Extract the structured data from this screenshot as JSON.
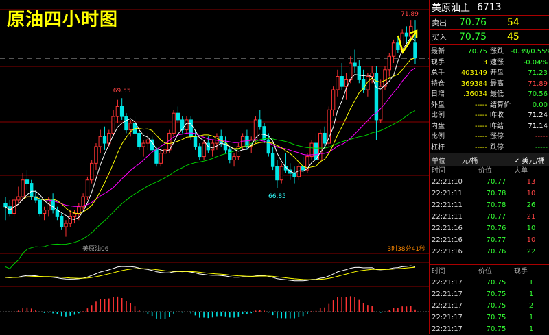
{
  "overlay_title": "原油四小时图",
  "chart": {
    "labels": {
      "high_mark": "69.55",
      "low_mark": "66.85",
      "peak_mark": "71.89"
    },
    "instrument": "美原油06",
    "countdown": "3时38分41秒"
  },
  "quote": {
    "name": "美原油主",
    "code": "6713",
    "ask_label": "卖出",
    "ask_price": "70.76",
    "ask_vol": "54",
    "bid_label": "买入",
    "bid_price": "70.75",
    "bid_vol": "45",
    "fields": [
      {
        "l1": "最新",
        "v1": "70.75",
        "c1": "g",
        "l2": "涨跌",
        "v2": "-0.39/0.55%",
        "c2": "g"
      },
      {
        "l1": "现手",
        "v1": "3",
        "c1": "y",
        "l2": "速涨",
        "v2": "-0.04%",
        "c2": "g"
      },
      {
        "l1": "总手",
        "v1": "403149",
        "c1": "y",
        "l2": "开盘",
        "v2": "71.23",
        "c2": "g"
      },
      {
        "l1": "持仓",
        "v1": "369384",
        "c1": "y",
        "l2": "最高",
        "v2": "71.89",
        "c2": "r"
      },
      {
        "l1": "日增",
        "v1": ".36034",
        "c1": "y",
        "l2": "最低",
        "v2": "70.56",
        "c2": "g"
      },
      {
        "l1": "外盘",
        "v1": "-----",
        "c1": "y",
        "l2": "结算价",
        "v2": "0.00",
        "c2": "g"
      },
      {
        "l1": "比例",
        "v1": "-----",
        "c1": "y",
        "l2": "昨收",
        "v2": "71.24",
        "c2": "w"
      },
      {
        "l1": "内盘",
        "v1": "-----",
        "c1": "y",
        "l2": "昨结",
        "v2": "71.14",
        "c2": "w"
      },
      {
        "l1": "比例",
        "v1": "-----",
        "c1": "y",
        "l2": "涨停",
        "v2": "-----",
        "c2": "r"
      },
      {
        "l1": "杠杆",
        "v1": "-----",
        "c1": "y",
        "l2": "跌停",
        "v2": "-----",
        "c2": "g"
      }
    ],
    "unit_label": "单位",
    "unit_yuan": "元/桶",
    "unit_usd": "✓ 美元/桶"
  },
  "ticks_big": {
    "headers": [
      "时间",
      "价位",
      "大单"
    ],
    "rows": [
      {
        "t": "22:21:10",
        "p": "70.77",
        "q": "13",
        "c": "r"
      },
      {
        "t": "22:21:11",
        "p": "70.78",
        "q": "10",
        "c": "r"
      },
      {
        "t": "22:21:11",
        "p": "70.78",
        "q": "26",
        "c": "g"
      },
      {
        "t": "22:21:11",
        "p": "70.77",
        "q": "21",
        "c": "r"
      },
      {
        "t": "22:21:16",
        "p": "70.76",
        "q": "10",
        "c": "g"
      },
      {
        "t": "22:21:16",
        "p": "70.77",
        "q": "10",
        "c": "r"
      },
      {
        "t": "22:21:16",
        "p": "70.76",
        "q": "22",
        "c": "g"
      }
    ]
  },
  "ticks": {
    "headers": [
      "时间",
      "价位",
      "现手"
    ],
    "rows": [
      {
        "t": "22:21:17",
        "p": "70.75",
        "q": "1",
        "c": "g"
      },
      {
        "t": "22:21:17",
        "p": "70.75",
        "q": "1",
        "c": "g"
      },
      {
        "t": "22:21:17",
        "p": "70.75",
        "q": "2",
        "c": "g"
      },
      {
        "t": "22:21:17",
        "p": "70.75",
        "q": "1",
        "c": "g"
      },
      {
        "t": "22:21:17",
        "p": "70.75",
        "q": "1",
        "c": "g"
      }
    ]
  },
  "colors": {
    "up": "#ff3333",
    "down": "#00e5e5",
    "ma1": "#ffffff",
    "ma2": "#ffff00",
    "ma3": "#ff00ff",
    "ma4": "#00cc00",
    "grid": "#8b0000"
  },
  "chart_data": {
    "type": "candlestick",
    "instrument": "美原油06",
    "ylim": [
      64.9,
      72.2
    ],
    "candles": [
      [
        66.4,
        66.6,
        65.9,
        66.3
      ],
      [
        66.3,
        66.5,
        66.0,
        66.1
      ],
      [
        66.1,
        66.6,
        66.0,
        66.5
      ],
      [
        66.5,
        66.9,
        66.4,
        66.6
      ],
      [
        66.6,
        67.3,
        66.5,
        67.1
      ],
      [
        67.1,
        67.4,
        66.8,
        67.0
      ],
      [
        67.0,
        67.1,
        66.5,
        66.6
      ],
      [
        66.6,
        66.8,
        66.4,
        66.5
      ],
      [
        66.5,
        66.6,
        66.0,
        66.1
      ],
      [
        66.1,
        66.3,
        65.9,
        66.2
      ],
      [
        66.2,
        66.6,
        66.0,
        66.5
      ],
      [
        66.5,
        66.7,
        66.1,
        66.2
      ],
      [
        66.2,
        66.3,
        65.9,
        66.0
      ],
      [
        66.0,
        66.1,
        65.6,
        65.7
      ],
      [
        65.7,
        65.9,
        65.4,
        65.8
      ],
      [
        65.8,
        66.2,
        65.7,
        66.0
      ],
      [
        66.0,
        66.2,
        65.8,
        66.1
      ],
      [
        66.1,
        66.4,
        65.9,
        66.3
      ],
      [
        66.3,
        66.7,
        66.2,
        66.6
      ],
      [
        66.6,
        67.2,
        66.5,
        67.1
      ],
      [
        67.1,
        67.7,
        67.0,
        67.6
      ],
      [
        67.6,
        68.2,
        67.4,
        68.1
      ],
      [
        68.1,
        68.6,
        67.9,
        68.4
      ],
      [
        68.4,
        68.7,
        68.0,
        68.2
      ],
      [
        68.2,
        68.6,
        68.1,
        68.5
      ],
      [
        68.5,
        69.2,
        68.4,
        69.0
      ],
      [
        69.0,
        69.5,
        68.8,
        69.3
      ],
      [
        69.3,
        69.55,
        68.9,
        69.0
      ],
      [
        69.0,
        69.1,
        68.5,
        68.6
      ],
      [
        68.6,
        68.9,
        68.4,
        68.8
      ],
      [
        68.8,
        69.0,
        68.4,
        68.5
      ],
      [
        68.5,
        68.6,
        68.0,
        68.1
      ],
      [
        68.1,
        68.3,
        67.8,
        68.2
      ],
      [
        68.2,
        68.5,
        68.0,
        68.3
      ],
      [
        68.3,
        68.4,
        67.9,
        68.0
      ],
      [
        68.0,
        68.1,
        67.5,
        67.6
      ],
      [
        67.6,
        68.0,
        67.5,
        67.9
      ],
      [
        67.9,
        68.2,
        67.7,
        68.0
      ],
      [
        68.0,
        68.6,
        67.9,
        68.5
      ],
      [
        68.5,
        69.2,
        68.4,
        69.1
      ],
      [
        69.1,
        69.3,
        68.8,
        68.9
      ],
      [
        68.9,
        69.0,
        68.5,
        68.6
      ],
      [
        68.6,
        69.0,
        68.5,
        68.9
      ],
      [
        68.9,
        69.0,
        68.3,
        68.4
      ],
      [
        68.4,
        68.6,
        68.0,
        68.1
      ],
      [
        68.1,
        68.2,
        67.7,
        67.8
      ],
      [
        67.8,
        68.3,
        67.7,
        68.2
      ],
      [
        68.2,
        68.4,
        67.9,
        68.0
      ],
      [
        68.0,
        68.3,
        67.8,
        68.2
      ],
      [
        68.2,
        68.5,
        68.0,
        68.4
      ],
      [
        68.4,
        68.6,
        68.1,
        68.2
      ],
      [
        68.2,
        68.4,
        67.9,
        68.0
      ],
      [
        68.0,
        68.1,
        67.6,
        67.7
      ],
      [
        67.7,
        67.9,
        67.5,
        67.8
      ],
      [
        67.8,
        68.2,
        67.7,
        68.1
      ],
      [
        68.1,
        68.5,
        68.0,
        68.4
      ],
      [
        68.4,
        68.6,
        68.0,
        68.1
      ],
      [
        68.1,
        68.4,
        67.9,
        68.3
      ],
      [
        68.3,
        69.0,
        68.2,
        68.9
      ],
      [
        68.9,
        69.2,
        68.6,
        68.7
      ],
      [
        68.7,
        68.8,
        68.2,
        68.3
      ],
      [
        68.3,
        68.5,
        67.8,
        67.9
      ],
      [
        67.9,
        68.1,
        67.4,
        67.5
      ],
      [
        67.5,
        67.7,
        66.85,
        67.1
      ],
      [
        67.1,
        67.6,
        67.0,
        67.5
      ],
      [
        67.5,
        67.9,
        67.3,
        67.4
      ],
      [
        67.4,
        67.6,
        67.1,
        67.3
      ],
      [
        67.3,
        67.5,
        67.0,
        67.2
      ],
      [
        67.2,
        67.6,
        67.1,
        67.5
      ],
      [
        67.5,
        67.8,
        67.3,
        67.4
      ],
      [
        67.4,
        67.9,
        67.3,
        67.8
      ],
      [
        67.8,
        68.3,
        67.7,
        68.2
      ],
      [
        68.2,
        68.5,
        67.6,
        67.7
      ],
      [
        67.7,
        68.6,
        67.6,
        68.5
      ],
      [
        68.5,
        68.7,
        68.1,
        68.2
      ],
      [
        68.2,
        69.3,
        68.1,
        69.2
      ],
      [
        69.2,
        69.9,
        69.0,
        69.8
      ],
      [
        69.8,
        70.4,
        69.6,
        70.2
      ],
      [
        70.2,
        70.6,
        69.8,
        69.9
      ],
      [
        69.9,
        70.3,
        69.5,
        70.1
      ],
      [
        70.1,
        70.8,
        70.0,
        70.6
      ],
      [
        70.6,
        71.0,
        70.3,
        70.5
      ],
      [
        70.5,
        70.7,
        70.0,
        70.1
      ],
      [
        70.1,
        70.4,
        69.7,
        69.8
      ],
      [
        69.8,
        70.3,
        69.6,
        70.2
      ],
      [
        70.2,
        70.5,
        70.0,
        70.3
      ],
      [
        70.3,
        70.5,
        68.3,
        68.9
      ],
      [
        68.9,
        70.1,
        68.8,
        69.9
      ],
      [
        69.9,
        70.5,
        69.8,
        70.4
      ],
      [
        70.4,
        70.9,
        70.2,
        70.8
      ],
      [
        70.8,
        71.3,
        70.6,
        71.2
      ],
      [
        71.2,
        71.4,
        70.9,
        71.0
      ],
      [
        71.0,
        71.6,
        70.9,
        71.5
      ],
      [
        71.5,
        71.7,
        71.2,
        71.4
      ],
      [
        71.4,
        71.89,
        71.3,
        71.7
      ],
      [
        71.2,
        71.89,
        70.56,
        70.75
      ]
    ]
  }
}
